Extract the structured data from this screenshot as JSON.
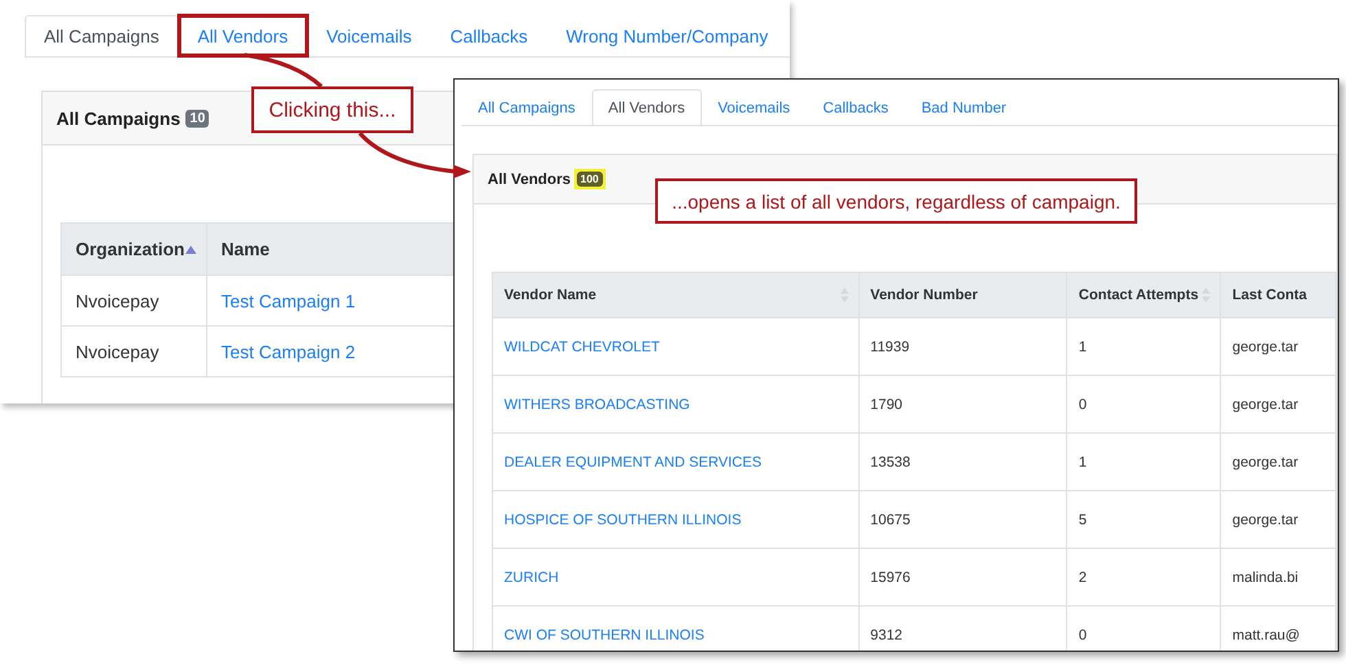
{
  "back_screen": {
    "tabs": [
      {
        "label": "All Campaigns",
        "selected": true,
        "highlighted": false
      },
      {
        "label": "All Vendors",
        "selected": false,
        "highlighted": true
      },
      {
        "label": "Voicemails",
        "selected": false,
        "highlighted": false
      },
      {
        "label": "Callbacks",
        "selected": false,
        "highlighted": false
      },
      {
        "label": "Wrong Number/Company",
        "selected": false,
        "highlighted": false
      }
    ],
    "card": {
      "title": "All Campaigns",
      "badge": "10",
      "badge_highlighted": false
    },
    "table": {
      "columns": [
        {
          "label": "Organization",
          "sortable": true,
          "sorted": true,
          "kind": "text"
        },
        {
          "label": "Name",
          "sortable": false,
          "sorted": false,
          "kind": "link"
        }
      ],
      "rows": [
        [
          "Nvoicepay",
          "Test Campaign 1"
        ],
        [
          "Nvoicepay",
          "Test Campaign 2"
        ]
      ]
    }
  },
  "front_screen": {
    "tabs": [
      {
        "label": "All Campaigns",
        "selected": false,
        "highlighted": false
      },
      {
        "label": "All Vendors",
        "selected": true,
        "highlighted": false
      },
      {
        "label": "Voicemails",
        "selected": false,
        "highlighted": false
      },
      {
        "label": "Callbacks",
        "selected": false,
        "highlighted": false
      },
      {
        "label": "Bad Number",
        "selected": false,
        "highlighted": false
      }
    ],
    "card": {
      "title": "All Vendors",
      "badge": "100",
      "badge_highlighted": true
    },
    "table": {
      "columns": [
        {
          "label": "Vendor Name",
          "sortable": true,
          "sorted": false,
          "kind": "link"
        },
        {
          "label": "Vendor Number",
          "sortable": false,
          "sorted": false,
          "kind": "text"
        },
        {
          "label": "Contact Attempts",
          "sortable": true,
          "sorted": false,
          "kind": "text"
        },
        {
          "label": "Last Conta",
          "sortable": false,
          "sorted": false,
          "kind": "text"
        }
      ],
      "rows": [
        [
          "WILDCAT CHEVROLET",
          "11939",
          "1",
          "george.tar"
        ],
        [
          "WITHERS BROADCASTING",
          "1790",
          "0",
          "george.tar"
        ],
        [
          "DEALER EQUIPMENT AND SERVICES",
          "13538",
          "1",
          "george.tar"
        ],
        [
          "HOSPICE OF SOUTHERN ILLINOIS",
          "10675",
          "5",
          "george.tar"
        ],
        [
          "ZURICH",
          "15976",
          "2",
          "malinda.bi"
        ],
        [
          "CWI OF SOUTHERN ILLINOIS",
          "9312",
          "0",
          "matt.rau@"
        ]
      ]
    }
  },
  "callouts": [
    {
      "text": "Clicking this..."
    },
    {
      "text": "...opens a list of all vendors, regardless of campaign."
    }
  ]
}
